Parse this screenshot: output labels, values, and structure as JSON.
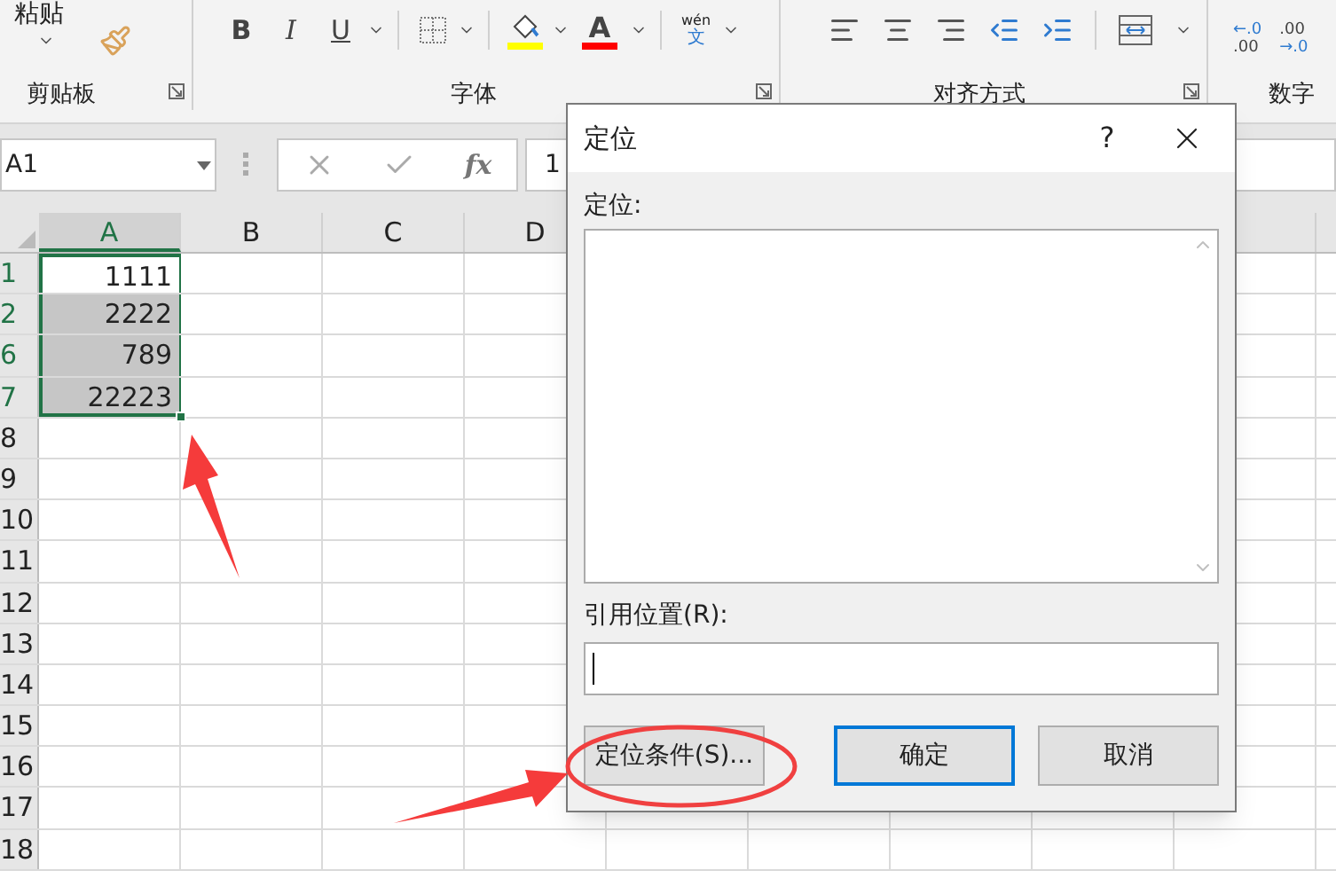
{
  "ribbon": {
    "clipboard": {
      "paste": "粘贴",
      "label": "剪贴板"
    },
    "font": {
      "bold": "B",
      "italic": "I",
      "underline": "U",
      "font_color": "A",
      "phonetic_top": "wén",
      "phonetic_bottom": "文",
      "label": "字体"
    },
    "alignment": {
      "label": "对齐方式"
    },
    "number": {
      "increase_decimal": [
        "←.0",
        ".00"
      ],
      "decrease_decimal": [
        ".00",
        "→.0"
      ],
      "label": "数字"
    }
  },
  "formula_bar": {
    "name_box": "A1",
    "fx": "fx",
    "value": "1"
  },
  "columns": [
    {
      "label": "A",
      "selected": true
    },
    {
      "label": "B",
      "selected": false
    },
    {
      "label": "C",
      "selected": false
    },
    {
      "label": "D",
      "selected": false
    }
  ],
  "rows": [
    {
      "header": "1",
      "value": "1111",
      "selected": true,
      "active": true
    },
    {
      "header": "2",
      "value": "2222",
      "selected": true,
      "active": false
    },
    {
      "header": "6",
      "value": "789",
      "selected": true,
      "active": false
    },
    {
      "header": "7",
      "value": "22223",
      "selected": true,
      "active": false
    },
    {
      "header": "8",
      "selected": false,
      "active": false
    },
    {
      "header": "9",
      "selected": false,
      "active": false
    },
    {
      "header": "10",
      "selected": false,
      "active": false
    },
    {
      "header": "11",
      "selected": false,
      "active": false
    },
    {
      "header": "12",
      "selected": false,
      "active": false
    },
    {
      "header": "13",
      "selected": false,
      "active": false
    },
    {
      "header": "14",
      "selected": false,
      "active": false
    },
    {
      "header": "15",
      "selected": false,
      "active": false
    },
    {
      "header": "16",
      "selected": false,
      "active": false
    },
    {
      "header": "17",
      "selected": false,
      "active": false
    },
    {
      "header": "18",
      "selected": false,
      "active": false
    }
  ],
  "dialog": {
    "title": "定位",
    "help": "?",
    "list_label": "定位:",
    "reference_label": "引用位置(R):",
    "buttons": [
      {
        "label": "定位条件(S)...",
        "default": false
      },
      {
        "label": "确定",
        "default": true
      },
      {
        "label": "取消",
        "default": false
      }
    ]
  }
}
